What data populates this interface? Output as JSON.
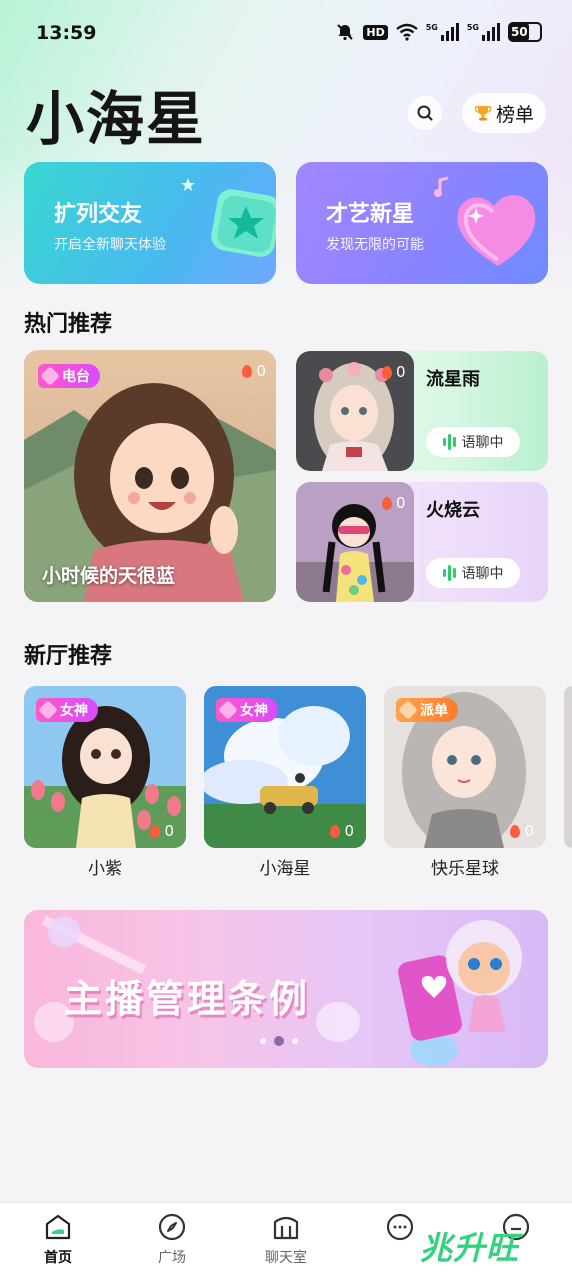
{
  "status_bar": {
    "time": "13:59",
    "hd": "HD",
    "network_1": "5G",
    "network_2": "5G",
    "battery": "50"
  },
  "header": {
    "app_title": "小海星",
    "rank_label": "榜单"
  },
  "feature_cards": [
    {
      "title": "扩列交友",
      "subtitle": "开启全新聊天体验"
    },
    {
      "title": "才艺新星",
      "subtitle": "发现无限的可能"
    }
  ],
  "hot": {
    "section_title": "热门推荐",
    "big": {
      "tag": "电台",
      "heat": "0",
      "caption": "小时候的天很蓝"
    },
    "small": [
      {
        "name": "流星雨",
        "heat": "0",
        "status": "语聊中"
      },
      {
        "name": "火烧云",
        "heat": "0",
        "status": "语聊中"
      }
    ]
  },
  "new_rooms": {
    "section_title": "新厅推荐",
    "rooms": [
      {
        "name": "小紫",
        "tag": "女神",
        "heat": "0"
      },
      {
        "name": "小海星",
        "tag": "女神",
        "heat": "0"
      },
      {
        "name": "快乐星球",
        "tag": "派单",
        "heat": "0"
      }
    ]
  },
  "banner": {
    "title": "主播管理条例",
    "page_count": 3,
    "active_page": 2
  },
  "bottom_nav": {
    "items": [
      {
        "label": "首页",
        "active": true
      },
      {
        "label": "广场",
        "active": false
      },
      {
        "label": "聊天室",
        "active": false
      }
    ],
    "watermark": "兆升旺"
  },
  "colors": {
    "voice_green": "#2ecb6b",
    "tag_pink": "#ff57c7",
    "tag_orange": "#ff8a3a",
    "heat_flame": "#ff5c3b"
  }
}
